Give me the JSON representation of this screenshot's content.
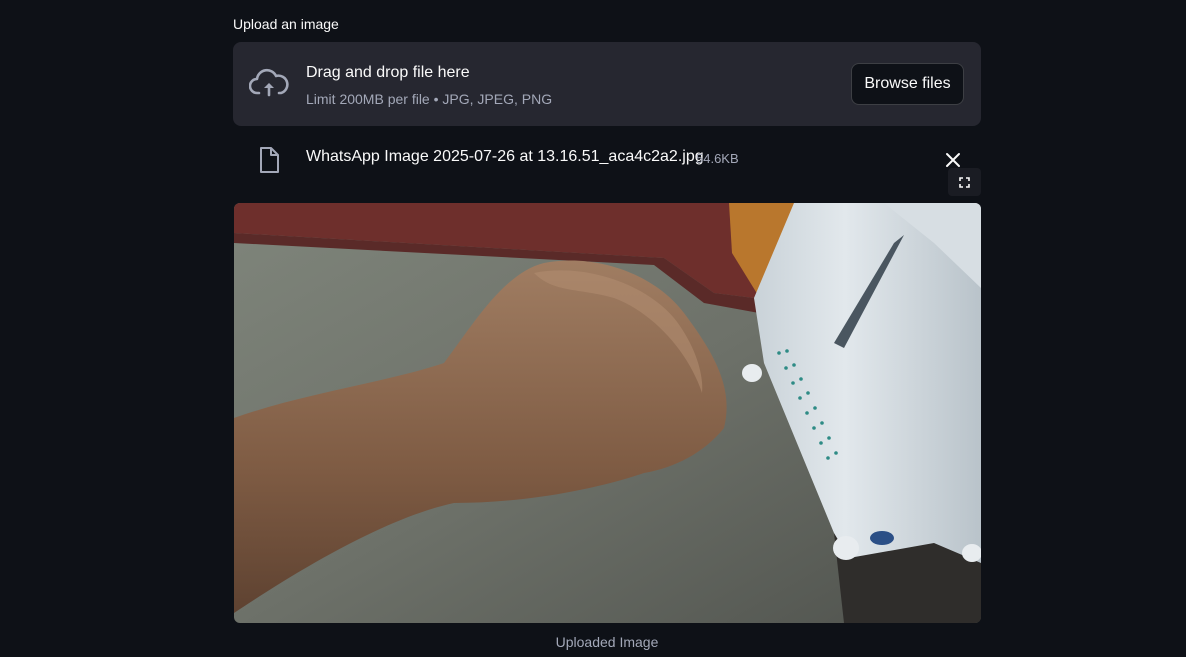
{
  "uploader": {
    "label": "Upload an image",
    "dropzone_title": "Drag and drop file here",
    "dropzone_limit": "Limit 200MB per file • JPG, JPEG, PNG",
    "browse_label": "Browse files",
    "icon": "cloud-upload-icon"
  },
  "file": {
    "name": "WhatsApp Image 2025-07-26 at 13.16.51_aca4c2a2.jpg",
    "size": "54.6KB",
    "icon": "file-icon",
    "remove_icon": "close-icon"
  },
  "image": {
    "caption": "Uploaded Image",
    "fullscreen_icon": "fullscreen-icon"
  },
  "colors": {
    "background": "#0e1117",
    "dropzone": "#262730",
    "muted_text": "#a3a8b8"
  }
}
